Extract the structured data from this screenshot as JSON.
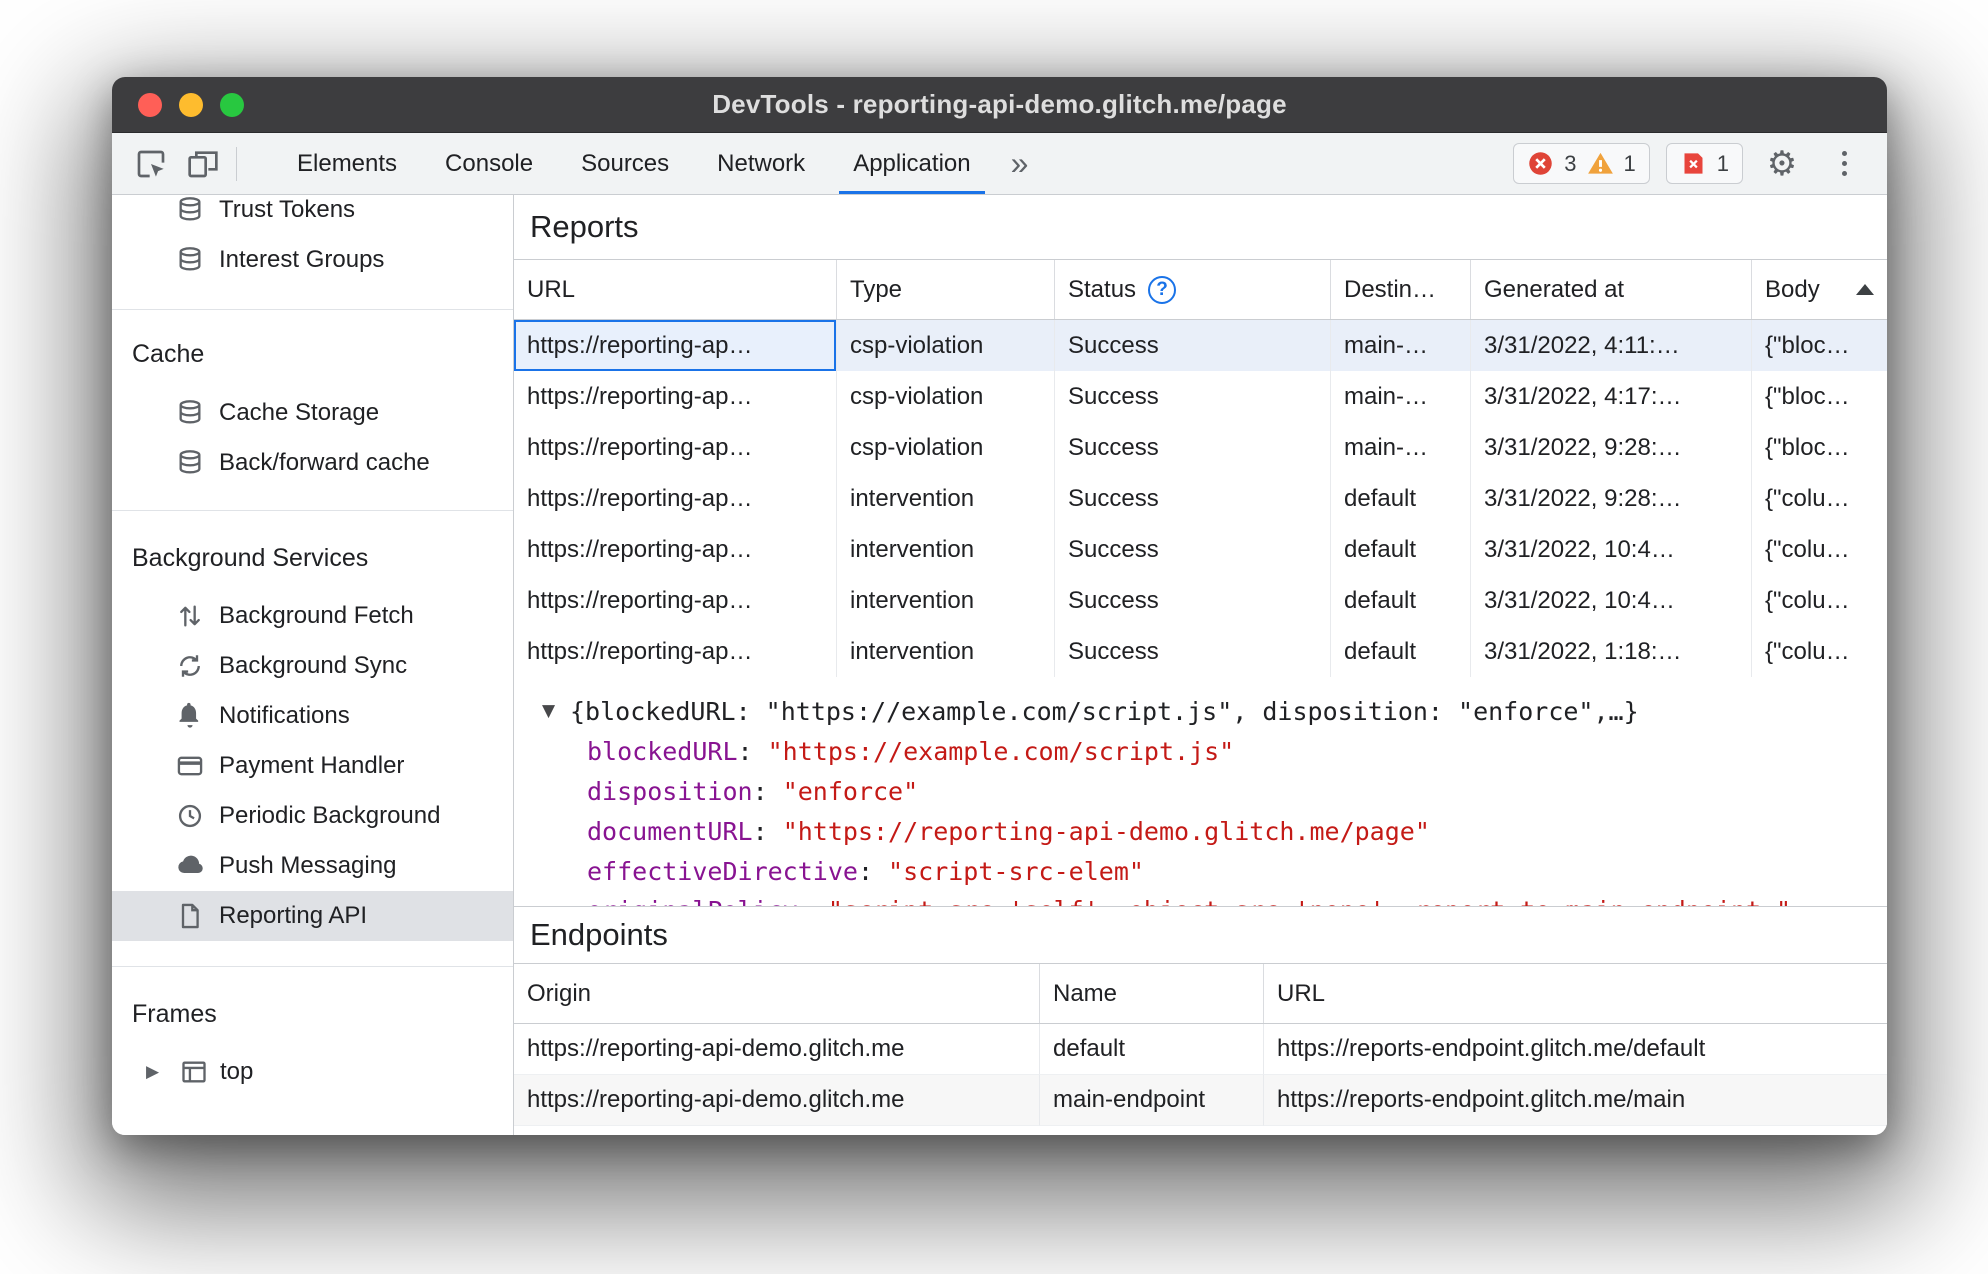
{
  "window": {
    "title": "DevTools - reporting-api-demo.glitch.me/page"
  },
  "toolbar": {
    "tabs": [
      {
        "label": "Elements"
      },
      {
        "label": "Console"
      },
      {
        "label": "Sources"
      },
      {
        "label": "Network"
      },
      {
        "label": "Application",
        "selected": true
      }
    ],
    "more_tabs_glyph": "»",
    "error_count": "3",
    "warning_count": "1",
    "issue_count": "1",
    "gear_glyph": "⚙",
    "colors": {
      "accent_blue": "#1a73e8",
      "error_red": "#df4437",
      "warning_orange": "#f0a23c",
      "issue_red": "#e8453c"
    }
  },
  "sidebar": {
    "trust_tokens": "Trust Tokens",
    "interest_groups": "Interest Groups",
    "cache_header": "Cache",
    "cache_storage": "Cache Storage",
    "back_forward_cache": "Back/forward cache",
    "background_services_header": "Background Services",
    "background_fetch": "Background Fetch",
    "background_sync": "Background Sync",
    "notifications": "Notifications",
    "payment_handler": "Payment Handler",
    "periodic_background": "Periodic Background",
    "push_messaging": "Push Messaging",
    "reporting_api": "Reporting API",
    "frames_header": "Frames",
    "frame_expander": "▶",
    "top_frame": "top"
  },
  "reports": {
    "title": "Reports",
    "columns": {
      "url": "URL",
      "type": "Type",
      "status": "Status",
      "destination": "Destin…",
      "generated": "Generated at",
      "body": "Body"
    },
    "status_help_glyph": "?",
    "rows": [
      {
        "url": "https://reporting-ap…",
        "type": "csp-violation",
        "status": "Success",
        "destination": "main-…",
        "generated": "3/31/2022, 4:11:…",
        "body": "{\"bloc…",
        "selected": true
      },
      {
        "url": "https://reporting-ap…",
        "type": "csp-violation",
        "status": "Success",
        "destination": "main-…",
        "generated": "3/31/2022, 4:17:…",
        "body": "{\"bloc…"
      },
      {
        "url": "https://reporting-ap…",
        "type": "csp-violation",
        "status": "Success",
        "destination": "main-…",
        "generated": "3/31/2022, 9:28:…",
        "body": "{\"bloc…"
      },
      {
        "url": "https://reporting-ap…",
        "type": "intervention",
        "status": "Success",
        "destination": "default",
        "generated": "3/31/2022, 9:28:…",
        "body": "{\"colu…"
      },
      {
        "url": "https://reporting-ap…",
        "type": "intervention",
        "status": "Success",
        "destination": "default",
        "generated": "3/31/2022, 10:4…",
        "body": "{\"colu…"
      },
      {
        "url": "https://reporting-ap…",
        "type": "intervention",
        "status": "Success",
        "destination": "default",
        "generated": "3/31/2022, 10:4…",
        "body": "{\"colu…"
      },
      {
        "url": "https://reporting-ap…",
        "type": "intervention",
        "status": "Success",
        "destination": "default",
        "generated": "3/31/2022, 1:18:…",
        "body": "{\"colu…"
      }
    ]
  },
  "preview": {
    "expander_glyph": "▼",
    "summary": "{blockedURL: \"https://example.com/script.js\", disposition: \"enforce\",…}",
    "separator": ": ",
    "properties": [
      {
        "key": "blockedURL",
        "value": "\"https://example.com/script.js\""
      },
      {
        "key": "disposition",
        "value": "\"enforce\""
      },
      {
        "key": "documentURL",
        "value": "\"https://reporting-api-demo.glitch.me/page\""
      },
      {
        "key": "effectiveDirective",
        "value": "\"script-src-elem\""
      },
      {
        "key": "originalPolicy",
        "value": "\"script-src 'self'; object-src 'none'; report-to main-endpoint;\"",
        "clipped": true
      }
    ]
  },
  "endpoints": {
    "title": "Endpoints",
    "columns": {
      "origin": "Origin",
      "name": "Name",
      "url": "URL"
    },
    "rows": [
      {
        "origin": "https://reporting-api-demo.glitch.me",
        "name": "default",
        "url": "https://reports-endpoint.glitch.me/default"
      },
      {
        "origin": "https://reporting-api-demo.glitch.me",
        "name": "main-endpoint",
        "url": "https://reports-endpoint.glitch.me/main"
      }
    ]
  }
}
